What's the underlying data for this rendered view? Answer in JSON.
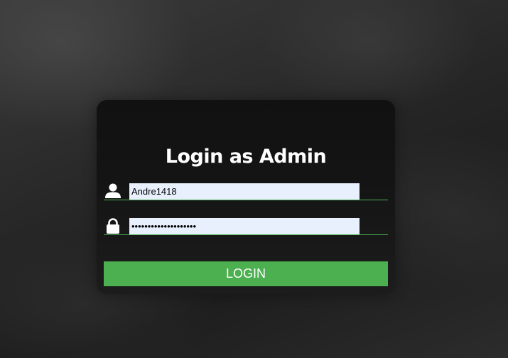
{
  "login": {
    "title": "Login as Admin",
    "username": {
      "icon": "user-icon",
      "value": "Andre1418"
    },
    "password": {
      "icon": "lock-icon",
      "value": "••••••••••••••••••••"
    },
    "submit_label": "LOGIN"
  },
  "colors": {
    "accent": "#4caf50",
    "input_background": "#e8f0fe",
    "card_background": "#141414",
    "text": "#ffffff"
  }
}
